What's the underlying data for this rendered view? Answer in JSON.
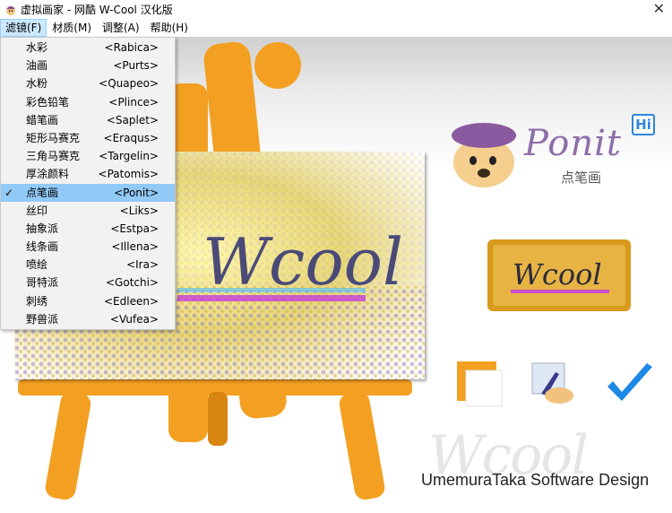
{
  "window": {
    "title": "虚拟画家 - 网酷 W-Cool 汉化版",
    "close_glyph": "✕"
  },
  "menubar": [
    {
      "label": "滤镜(F)",
      "active": true
    },
    {
      "label": "材质(M)"
    },
    {
      "label": "调整(A)"
    },
    {
      "label": "帮助(H)"
    }
  ],
  "filter_menu": [
    {
      "label": "水彩",
      "shortcut": "<Rabica>"
    },
    {
      "label": "油画",
      "shortcut": "<Purts>"
    },
    {
      "label": "水粉",
      "shortcut": "<Quapeo>"
    },
    {
      "label": "彩色铅笔",
      "shortcut": "<Plince>"
    },
    {
      "label": "蜡笔画",
      "shortcut": "<Saplet>"
    },
    {
      "label": "矩形马赛克",
      "shortcut": "<Eraqus>"
    },
    {
      "label": "三角马赛克",
      "shortcut": "<Targelin>"
    },
    {
      "label": "厚涂颜料",
      "shortcut": "<Patomis>"
    },
    {
      "label": "点笔画",
      "shortcut": "<Ponit>",
      "checked": true
    },
    {
      "label": "丝印",
      "shortcut": "<Liks>"
    },
    {
      "label": "抽象派",
      "shortcut": "<Estpa>"
    },
    {
      "label": "线条画",
      "shortcut": "<Illena>"
    },
    {
      "label": "喷绘",
      "shortcut": "<Ira>"
    },
    {
      "label": "哥特派",
      "shortcut": "<Gotchi>"
    },
    {
      "label": "刺绣",
      "shortcut": "<Edleen>"
    },
    {
      "label": "野兽派",
      "shortcut": "<Vufea>"
    }
  ],
  "logo": {
    "name": "Ponit",
    "subtitle": "点笔画",
    "badge": "Hi"
  },
  "canvas_text": "Wcool",
  "thumbnail_text": "Wcool",
  "watermark_text": "Wcool",
  "credit": "UmemuraTaka Software Design",
  "colors": {
    "easel": "#f3a022",
    "easel_dark": "#d98512",
    "menu_highlight": "#91c9f7",
    "ponit_purple": "#8e6ea8",
    "check_blue": "#1e88e5"
  }
}
